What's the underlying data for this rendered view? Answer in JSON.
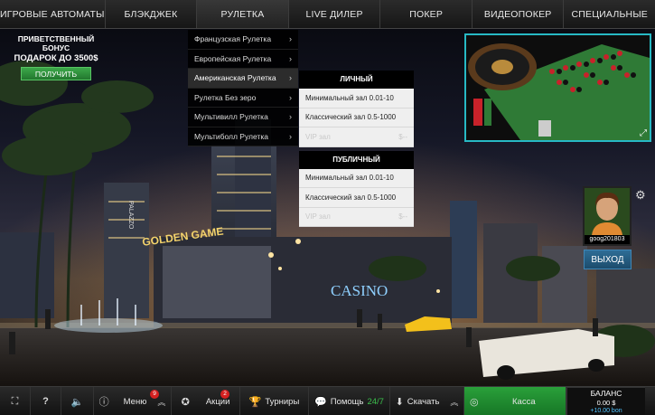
{
  "nav": {
    "tabs": [
      "ИГРОВЫЕ АВТОМАТЫ",
      "БЛЭКДЖЕК",
      "РУЛЕТКА",
      "LIVE ДИЛЕР",
      "ПОКЕР",
      "ВИДЕОПОКЕР",
      "СПЕЦИАЛЬНЫЕ"
    ],
    "active": "РУЛЕТКА"
  },
  "bonus": {
    "line1": "ПРИВЕТСТВЕННЫЙ БОНУС",
    "line2": "ПОДАРОК ДО 3500$",
    "button": "ПОЛУЧИТЬ"
  },
  "roulette_menu": {
    "items": [
      "Французская Рулетка",
      "Европейская Рулетка",
      "Американская Рулетка",
      "Рулетка Без зеро",
      "Мультивилл Рулетка",
      "Мультиболл Рулетка"
    ],
    "arrow": "›"
  },
  "submenu": {
    "private_title": "ЛИЧНЫЙ",
    "private_options": [
      {
        "label": "Минимальный зал 0.01-10",
        "suffix": ""
      },
      {
        "label": "Классический зал 0.5-1000",
        "suffix": ""
      },
      {
        "label": "VIP зал",
        "suffix": "$--"
      }
    ],
    "public_title": "ПУБЛИЧНЫЙ",
    "public_options": [
      {
        "label": "Минимальный зал 0.01-10",
        "suffix": ""
      },
      {
        "label": "Классический зал 0.5-1000",
        "suffix": ""
      },
      {
        "label": "VIP зал",
        "suffix": "$--"
      }
    ]
  },
  "scene_signs": {
    "casino": "CASINO",
    "golden_game": "GOLDEN GAME",
    "palazzo": "PALAZZO"
  },
  "player": {
    "name": "goog201803",
    "exit": "ВЫХОД"
  },
  "bottom": {
    "menu": "Меню",
    "menu_badge": "9",
    "promos": "Акции",
    "promos_badge": "2",
    "tournaments": "Турниры",
    "help": "Помощь",
    "help_hours": "24/7",
    "download": "Скачать",
    "cashier": "Касса",
    "balance_title": "БАЛАНС",
    "balance_value": "0.00 $",
    "balance_bonus": "+10.00 bon"
  },
  "colors": {
    "accent_teal": "#27b9c4",
    "cash_green": "#2aa03a",
    "exit_blue": "#2e6d96",
    "badge_red": "#d42020"
  },
  "icons": [
    "fullscreen-icon",
    "help-icon",
    "sound-icon",
    "info-icon",
    "chevron-up-icon",
    "award-icon",
    "trophy-icon",
    "chat-icon",
    "download-icon",
    "coins-icon",
    "gear-icon",
    "expand-icon"
  ]
}
